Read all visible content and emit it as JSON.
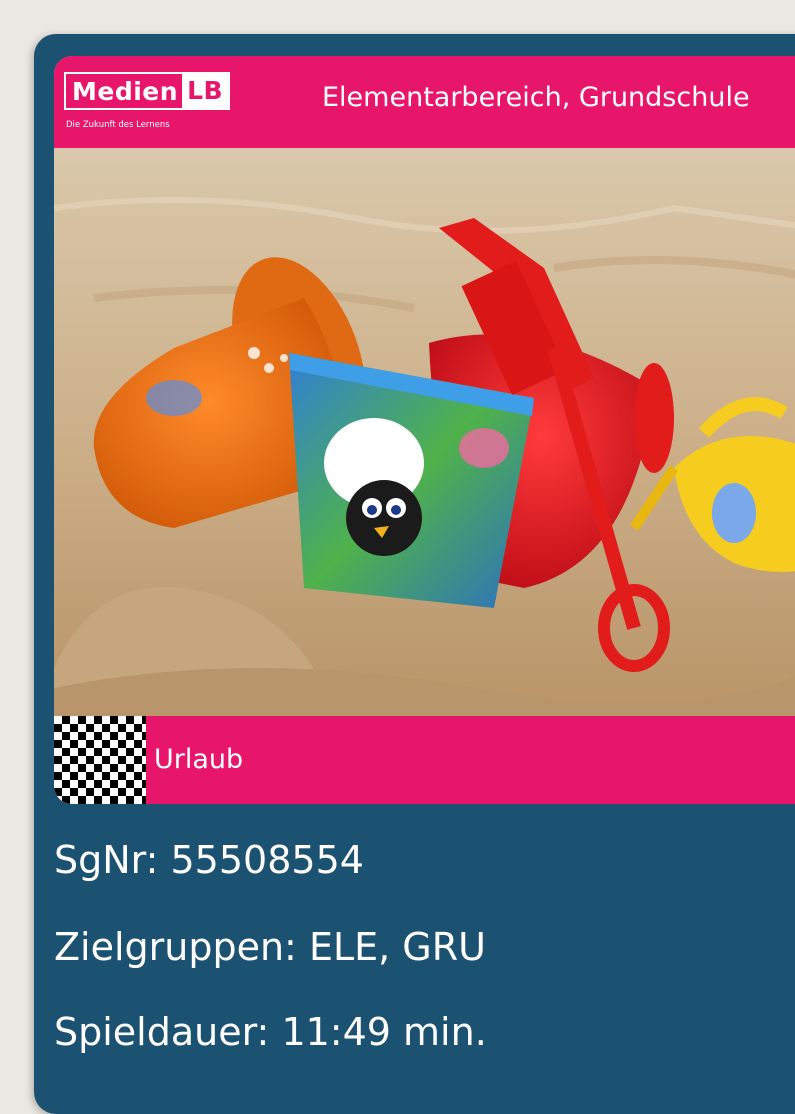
{
  "logo": {
    "brand_text": "Medien",
    "brand_suffix": "LB",
    "tagline": "Die Zukunft des Lernens"
  },
  "header": {
    "target_levels": "Elementarbereich, Grundschule"
  },
  "media": {
    "title": "Urlaub",
    "image_description_icon": "sand-toys-photo"
  },
  "details": {
    "sgnr": "SgNr: 55508554",
    "zielgruppen": "Zielgruppen: ELE, GRU",
    "spieldauer": "Spieldauer: 11:49 min."
  },
  "colors": {
    "card_bg": "#1c5271",
    "accent_pink": "#e8166b",
    "page_bg": "#ebe8e3"
  }
}
